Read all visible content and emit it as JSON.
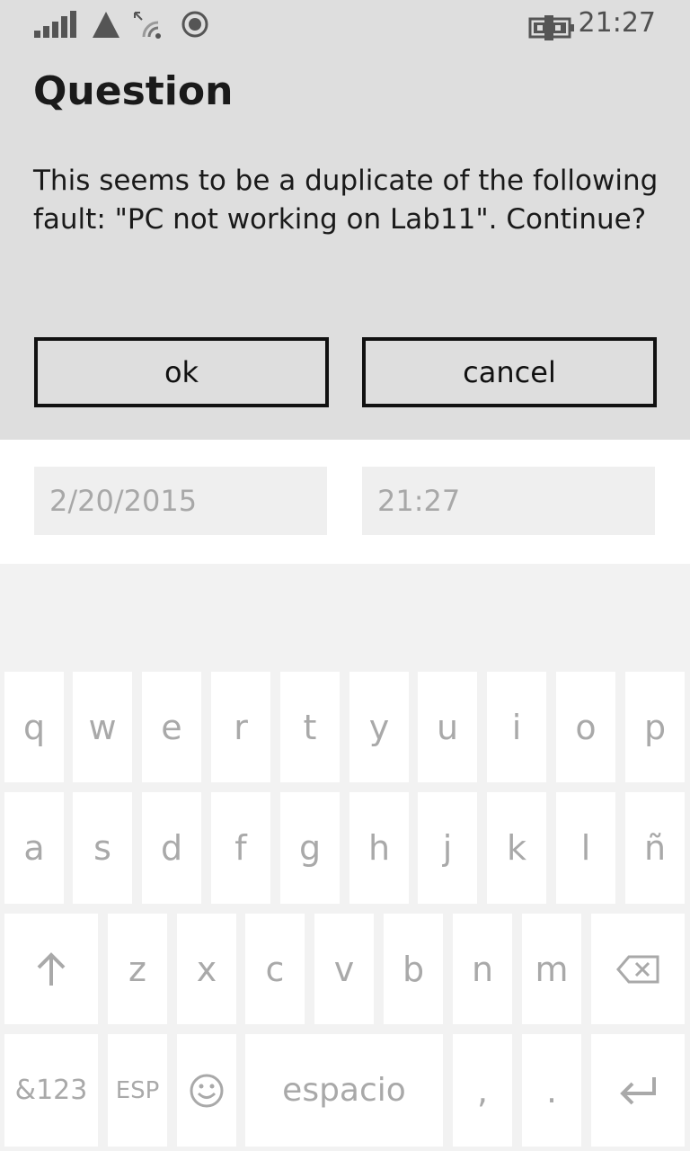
{
  "status": {
    "time": "21:27"
  },
  "dialog": {
    "title": "Question",
    "message": "This seems to be a duplicate of the following fault: \"PC not working on Lab11\". Continue?",
    "ok_label": "ok",
    "cancel_label": "cancel"
  },
  "form": {
    "date_value": "2/20/2015",
    "time_value": "21:27"
  },
  "keyboard": {
    "row1": [
      "q",
      "w",
      "e",
      "r",
      "t",
      "y",
      "u",
      "i",
      "o",
      "p"
    ],
    "row2": [
      "a",
      "s",
      "d",
      "f",
      "g",
      "h",
      "j",
      "k",
      "l",
      "ñ"
    ],
    "row3": [
      "z",
      "x",
      "c",
      "v",
      "b",
      "n",
      "m"
    ],
    "numbers_label": "&123",
    "language_label": "ESP",
    "space_label": "espacio",
    "comma": ",",
    "period": "."
  }
}
